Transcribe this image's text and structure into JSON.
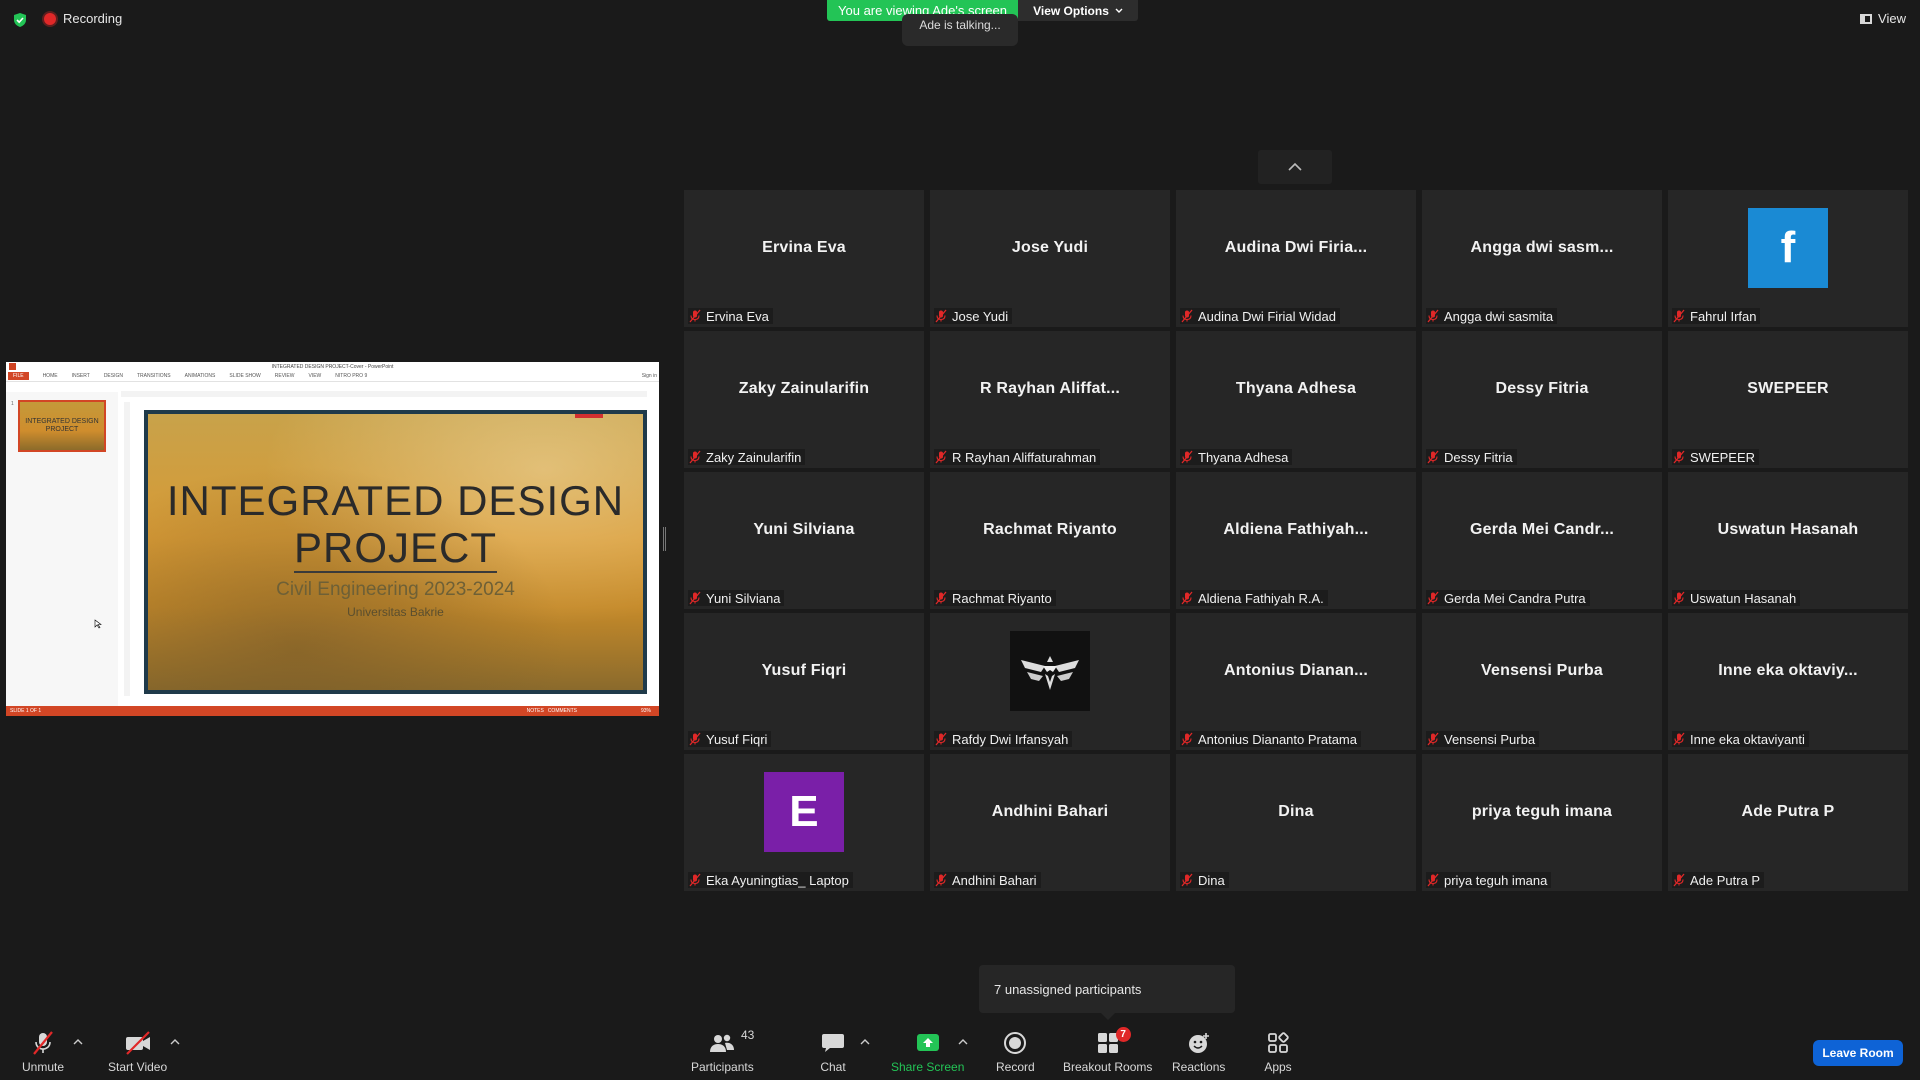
{
  "top": {
    "recording_label": "Recording",
    "viewing_banner": "You are viewing Ade's screen",
    "talking": "Ade is talking...",
    "view_options": "View Options",
    "view_label": "View"
  },
  "share": {
    "window_title": "INTEGRATED DESIGN PROJECT-Cover - PowerPoint",
    "ribbon_tabs": [
      "FILE",
      "HOME",
      "INSERT",
      "DESIGN",
      "TRANSITIONS",
      "ANIMATIONS",
      "SLIDE SHOW",
      "REVIEW",
      "VIEW",
      "NITRO PRO 9"
    ],
    "sign_in": "Sign in",
    "thumb_title": "INTEGRATED DESIGN PROJECT",
    "thumb_number": "1",
    "slide_title_line1": "INTEGRATED DESIGN",
    "slide_title_line2": "PROJECT",
    "slide_subtitle": "Civil Engineering 2023-2024",
    "slide_org": "Universitas Bakrie",
    "status_left": "SLIDE 1 OF 1",
    "status_notes": "NOTES",
    "status_comments": "COMMENTS",
    "zoom": "93%"
  },
  "gallery": {
    "tiles": [
      {
        "display": "Ervina Eva",
        "name": "Ervina Eva"
      },
      {
        "display": "Jose Yudi",
        "name": "Jose Yudi"
      },
      {
        "display": "Audina  Dwi  Firia...",
        "name": "Audina Dwi Firial Widad"
      },
      {
        "display": "Angga  dwi  sasm...",
        "name": "Angga dwi sasmita"
      },
      {
        "display": "",
        "name": "Fahrul Irfan",
        "avatar": "f",
        "avatar_color": "#1a8ad4"
      },
      {
        "display": "Zaky  Zainularifin",
        "name": "Zaky Zainularifin"
      },
      {
        "display": "R  Rayhan  Aliffat...",
        "name": "R Rayhan Aliffaturahman"
      },
      {
        "display": "Thyana  Adhesa",
        "name": "Thyana Adhesa"
      },
      {
        "display": "Dessy  Fitria",
        "name": "Dessy Fitria"
      },
      {
        "display": "SWEPEER",
        "name": "SWEPEER"
      },
      {
        "display": "Yuni  Silviana",
        "name": "Yuni Silviana"
      },
      {
        "display": "Rachmat  Riyanto",
        "name": "Rachmat Riyanto"
      },
      {
        "display": "Aldiena  Fathiyah...",
        "name": "Aldiena Fathiyah R.A."
      },
      {
        "display": "Gerda  Mei  Candr...",
        "name": "Gerda Mei Candra Putra"
      },
      {
        "display": "Uswatun  Hasanah",
        "name": "Uswatun Hasanah"
      },
      {
        "display": "Yusuf  Fiqri",
        "name": "Yusuf Fiqri"
      },
      {
        "display": "",
        "name": "Rafdy Dwi Irfansyah",
        "avatar": "logo",
        "avatar_color": "#111111"
      },
      {
        "display": "Antonius  Dianan...",
        "name": "Antonius Diananto Pratama"
      },
      {
        "display": "Vensensi  Purba",
        "name": "Vensensi Purba"
      },
      {
        "display": "Inne  eka  oktaviy...",
        "name": "Inne eka oktaviyanti"
      },
      {
        "display": "",
        "name": "Eka Ayuningtias_ Laptop",
        "avatar": "E",
        "avatar_color": "#7a1fa8"
      },
      {
        "display": "Andhini  Bahari",
        "name": "Andhini Bahari"
      },
      {
        "display": "Dina",
        "name": "Dina"
      },
      {
        "display": "priya  teguh  imana",
        "name": "priya teguh imana"
      },
      {
        "display": "Ade  Putra  P",
        "name": "Ade Putra P"
      }
    ]
  },
  "unassigned": "7 unassigned participants",
  "toolbar": {
    "unmute": "Unmute",
    "start_video": "Start Video",
    "participants": "Participants",
    "participants_count": "43",
    "chat": "Chat",
    "share_screen": "Share Screen",
    "record": "Record",
    "breakout_rooms": "Breakout Rooms",
    "breakout_badge": "7",
    "reactions": "Reactions",
    "apps": "Apps",
    "leave": "Leave Room"
  },
  "colors": {
    "share_green": "#23c456",
    "leave_blue": "#0e63d6",
    "record_red": "#e02828",
    "mute_red": "#e02828"
  }
}
